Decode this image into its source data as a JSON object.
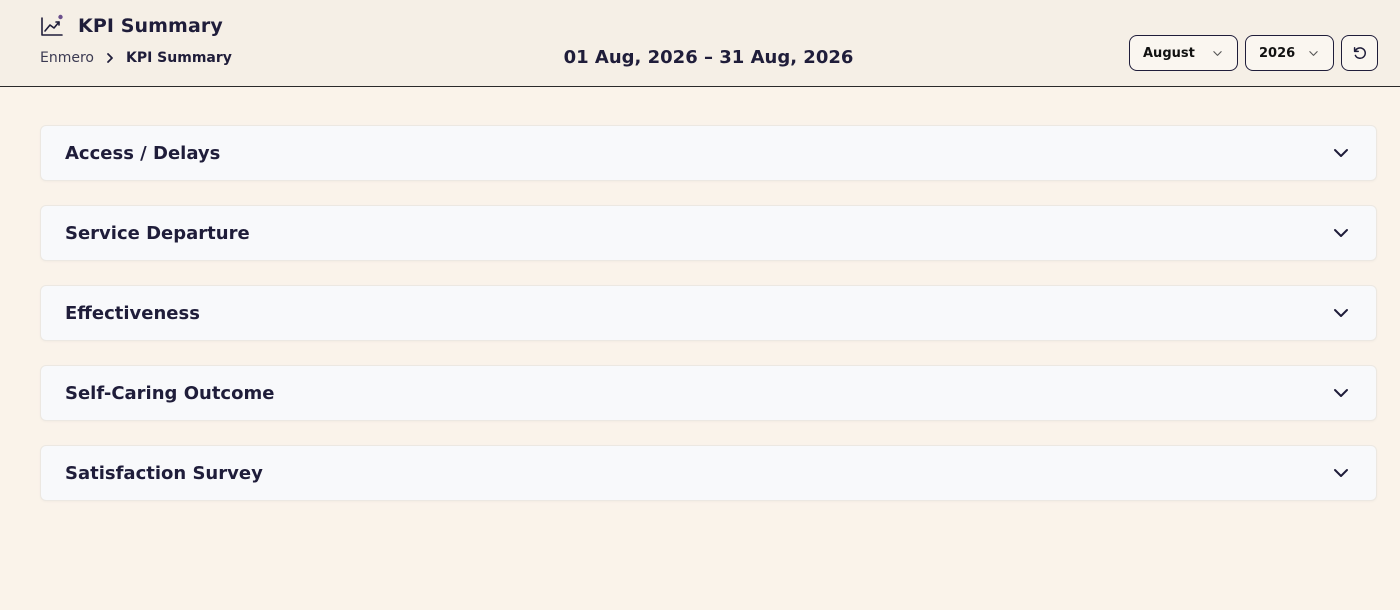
{
  "header": {
    "title": "KPI Summary",
    "title_icon": "trending-chart-icon",
    "breadcrumb": {
      "root": "Enmero",
      "current": "KPI Summary"
    },
    "date_range": "01 Aug, 2026 – 31 Aug, 2026",
    "month_select": {
      "value": "August"
    },
    "year_select": {
      "value": "2026"
    },
    "reset_icon": "refresh-icon"
  },
  "sections": [
    {
      "title": "Access / Delays"
    },
    {
      "title": "Service Departure"
    },
    {
      "title": "Effectiveness"
    },
    {
      "title": "Self-Caring Outcome"
    },
    {
      "title": "Satisfaction Survey"
    }
  ],
  "colors": {
    "page_background": "#faf3ea",
    "header_background": "#f5efe6",
    "card_background": "#f8f9fb",
    "text_primary": "#1f1d3a",
    "accent_dot": "#6b4f8c"
  }
}
